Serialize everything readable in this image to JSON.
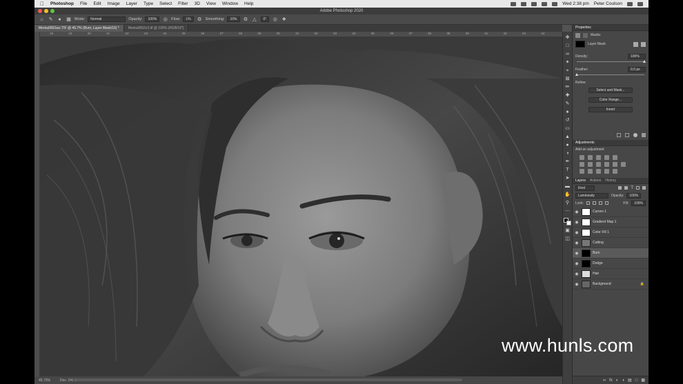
{
  "menubar": {
    "items": [
      "Photoshop",
      "File",
      "Edit",
      "Image",
      "Layer",
      "Type",
      "Select",
      "Filter",
      "3D",
      "View",
      "Window",
      "Help"
    ],
    "clock": "Wed 2:38 pm",
    "user": "Peter Coulson"
  },
  "window": {
    "title": "Adobe Photoshop 2020"
  },
  "options": {
    "mode_label": "Mode:",
    "mode_value": "Normal",
    "opacity_label": "Opacity:",
    "opacity_value": "100%",
    "flow_label": "Flow:",
    "flow_value": "1%",
    "smoothing_label": "Smoothing:",
    "smoothing_value": "10%",
    "angle_value": "0°"
  },
  "tabs": [
    {
      "label": "Merka0062acr.TIF @ 45.7% (Burn, Layer Mask/16) *"
    },
    {
      "label": "Merka0062c3.tif @ 100% (RGB/16*)"
    }
  ],
  "ruler": {
    "ticks": [
      "18",
      "19",
      "20",
      "21",
      "22",
      "23",
      "24",
      "25",
      "26",
      "27",
      "28",
      "29",
      "30",
      "31",
      "32",
      "33",
      "34",
      "35",
      "36",
      "37",
      "38",
      "39",
      "40",
      "41",
      "42",
      "43",
      "44"
    ]
  },
  "status": {
    "zoom": "45.73%",
    "doc": "Doc: 241.9M/287.9M"
  },
  "properties": {
    "title": "Properties",
    "section": "Masks",
    "mask_label": "Layer Mask",
    "density_label": "Density:",
    "density_value": "100%",
    "feather_label": "Feather:",
    "feather_value": "0.0 px",
    "refine_label": "Refine:",
    "select_mask": "Select and Mask...",
    "color_range": "Color Range...",
    "invert": "Invert"
  },
  "adjustments": {
    "title": "Adjustments",
    "hint": "Add an adjustment"
  },
  "layers_panel": {
    "tabs": [
      "Layers",
      "Actions",
      "History"
    ],
    "filter_kind": "Kind",
    "blend_mode": "Luminosity",
    "opacity_label": "Opacity:",
    "opacity_value": "100%",
    "lock_label": "Lock:",
    "fill_label": "Fill:",
    "fill_value": "100%",
    "layers": [
      {
        "name": "Curves 1",
        "thumb": "#ffffff",
        "selected": false
      },
      {
        "name": "Gradient Map 1",
        "thumb": "#ffffff",
        "selected": false
      },
      {
        "name": "Color Fill 1",
        "thumb": "#ffffff",
        "selected": false
      },
      {
        "name": "Cutting",
        "thumb": "#777777",
        "selected": false
      },
      {
        "name": "Burn",
        "thumb": "#000000",
        "selected": true
      },
      {
        "name": "Dodge",
        "thumb": "#000000",
        "selected": false
      },
      {
        "name": "Hair",
        "thumb": "#dddddd",
        "selected": false
      },
      {
        "name": "Background",
        "thumb": "#666666",
        "selected": false
      }
    ]
  },
  "watermark": "www.hunls.com"
}
